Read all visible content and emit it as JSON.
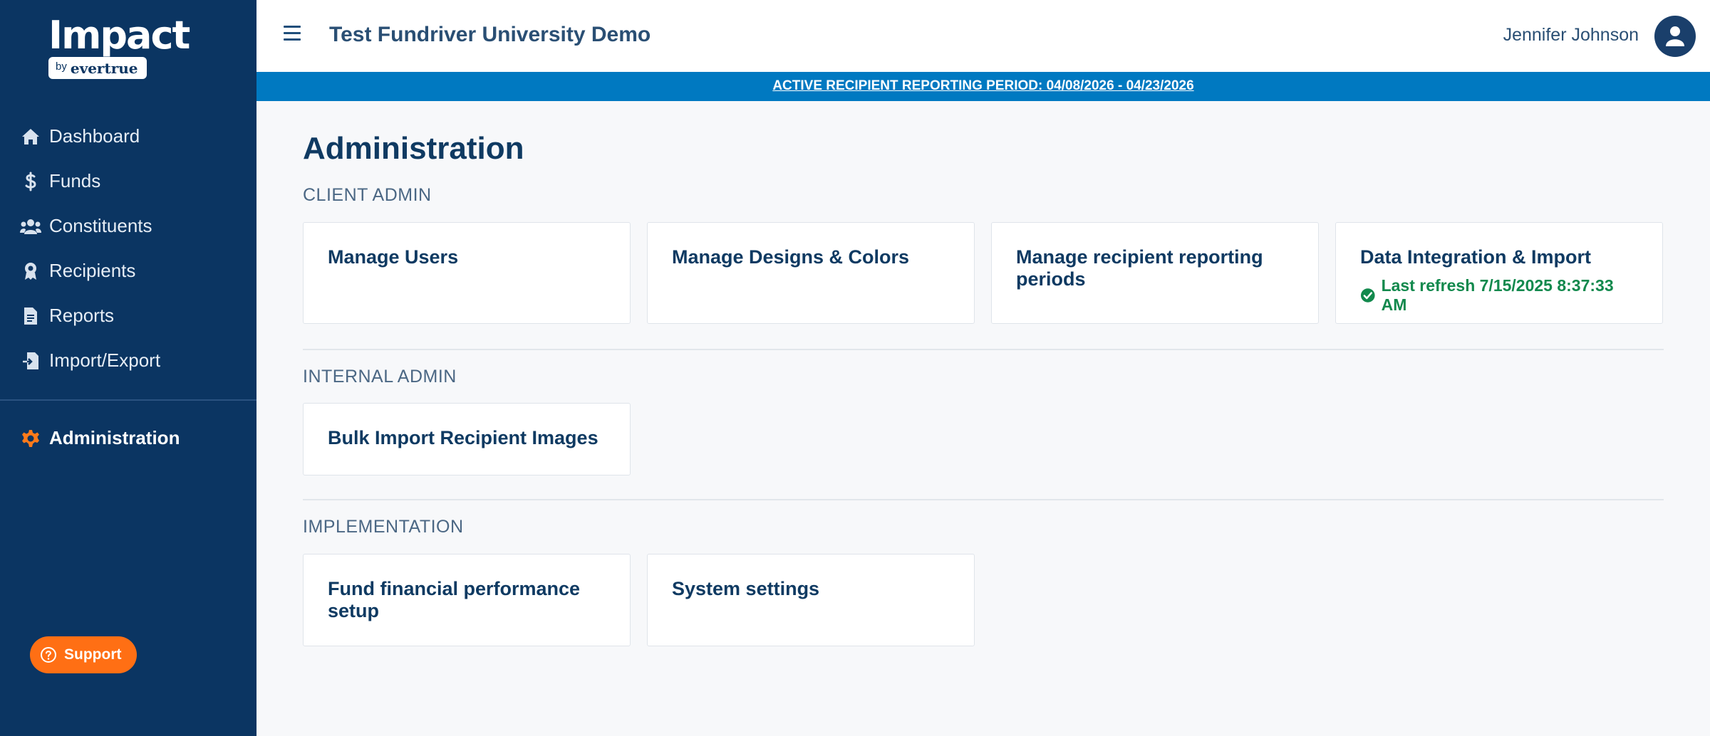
{
  "brand": {
    "name": "Impact",
    "by": "by",
    "company": "evertrue"
  },
  "sidebar": {
    "items": [
      {
        "label": "Dashboard",
        "icon": "home-icon"
      },
      {
        "label": "Funds",
        "icon": "dollar-icon"
      },
      {
        "label": "Constituents",
        "icon": "users-icon"
      },
      {
        "label": "Recipients",
        "icon": "award-icon"
      },
      {
        "label": "Reports",
        "icon": "document-icon"
      },
      {
        "label": "Import/Export",
        "icon": "file-import-icon"
      }
    ],
    "active": {
      "label": "Administration",
      "icon": "gear-icon",
      "color": "#ff7a1a"
    },
    "support_label": "Support"
  },
  "header": {
    "org_title": "Test Fundriver University Demo",
    "user_name": "Jennifer Johnson"
  },
  "banner": {
    "text": "ACTIVE RECIPIENT REPORTING PERIOD: 04/08/2026 - 04/23/2026"
  },
  "main": {
    "title": "Administration",
    "sections": [
      {
        "label": "CLIENT ADMIN",
        "cards": [
          {
            "title": "Manage Users"
          },
          {
            "title": "Manage Designs & Colors"
          },
          {
            "title": "Manage recipient reporting periods"
          },
          {
            "title": "Data Integration & Import",
            "status": "Last refresh 7/15/2025 8:37:33 AM",
            "status_color": "#12894d"
          }
        ]
      },
      {
        "label": "INTERNAL ADMIN",
        "cards": [
          {
            "title": "Bulk Import Recipient Images"
          }
        ]
      },
      {
        "label": "IMPLEMENTATION",
        "cards": [
          {
            "title": "Fund financial performance setup"
          },
          {
            "title": "System settings"
          }
        ]
      }
    ]
  },
  "colors": {
    "sidebar_bg": "#0b3562",
    "banner_bg": "#0079c1",
    "accent": "#ff6f14",
    "success": "#12894d"
  }
}
